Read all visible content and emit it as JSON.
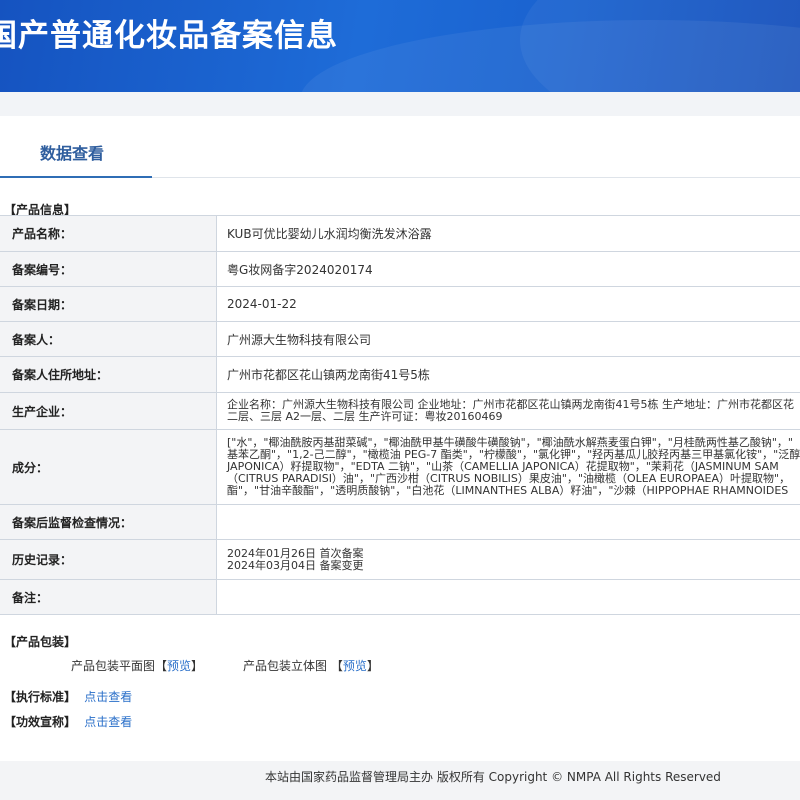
{
  "header": {
    "title": "国产普通化妆品备案信息"
  },
  "tabs": {
    "active": "数据查看"
  },
  "product_info": {
    "section_label": "【产品信息】",
    "rows": [
      {
        "label": "产品名称：",
        "value": "KUB可优比婴幼儿水润均衡洗发沐浴露"
      },
      {
        "label": "备案编号：",
        "value": "粤G妆网备字2024020174"
      },
      {
        "label": "备案日期：",
        "value": "2024-01-22"
      },
      {
        "label": "备案人：",
        "value": "广州源大生物科技有限公司"
      },
      {
        "label": "备案人住所地址：",
        "value": "广州市花都区花山镇两龙南街41号5栋"
      },
      {
        "label": "生产企业：",
        "lines": [
          "企业名称：广州源大生物科技有限公司 企业地址：广州市花都区花山镇两龙南街41号5栋 生产地址：广州市花都区花",
          "二层、三层 A2一层、二层 生产许可证：粤妆20160469"
        ]
      },
      {
        "label": "成分：",
        "lines": [
          "[\"水\"，\"椰油酰胺丙基甜菜碱\"，\"椰油酰甲基牛磺酸牛磺酸钠\"，\"椰油酰水解燕麦蛋白钾\"，\"月桂酰两性基乙酸钠\"，\"",
          "基苯乙酮\"，\"1,2-己二醇\"，\"橄榄油 PEG-7 酯类\"，\"柠檬酸\"，\"氯化钾\"，\"羟丙基瓜儿胶羟丙基三甲基氯化铵\"，\"泛醇",
          "JAPONICA）籽提取物\"，\"EDTA 二钠\"，\"山茶（CAMELLIA JAPONICA）花提取物\"，\"茉莉花（JASMINUM SAM",
          "（CITRUS PARADISI）油\"，\"广西沙柑（CITRUS NOBILIS）果皮油\"，\"油橄榄（OLEA EUROPAEA）叶提取物\"，",
          "酯\"，\"甘油辛酸酯\"，\"透明质酸钠\"，\"白池花（LIMNANTHES ALBA）籽油\"，\"沙棘（HIPPOPHAE RHAMNOIDES"
        ]
      },
      {
        "label": "备案后监督检查情况：",
        "value": ""
      },
      {
        "label": "历史记录：",
        "lines": [
          "2024年01月26日 首次备案",
          "2024年03月04日 备案变更"
        ]
      },
      {
        "label": "备注：",
        "value": ""
      }
    ]
  },
  "packaging": {
    "section_label": "【产品包装】",
    "flat_label": "产品包装平面图",
    "flat_link": "预览",
    "solid_label": "产品包装立体图",
    "solid_link": "预览"
  },
  "standard": {
    "section_label": "【执行标准】",
    "link": "点击查看"
  },
  "efficacy": {
    "section_label": "【功效宣称】",
    "link": "点击查看"
  },
  "footer": {
    "text": "本站由国家药品监督管理局主办 版权所有 Copyright © NMPA All Rights Reserved"
  }
}
